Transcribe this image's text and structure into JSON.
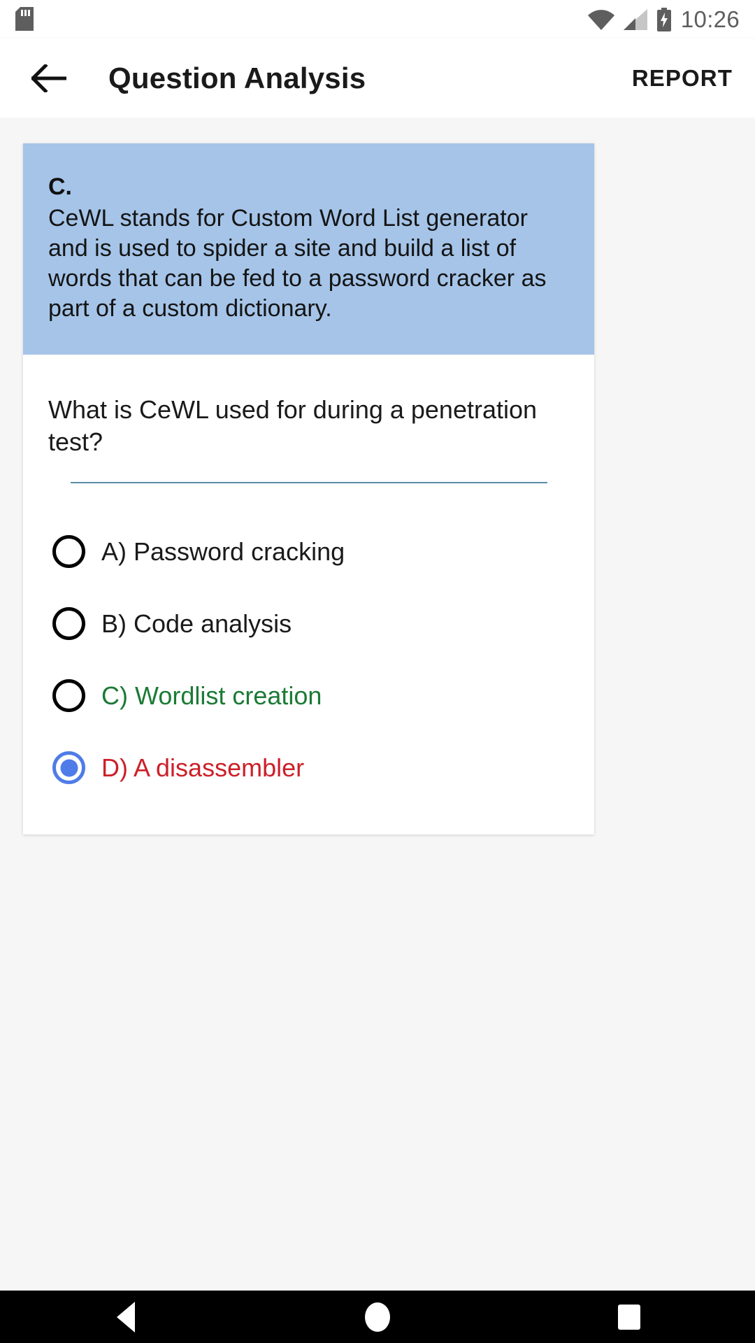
{
  "status_bar": {
    "time": "10:26",
    "icons": [
      "sd-card-icon",
      "wifi-icon",
      "cellular-signal-icon",
      "battery-charging-icon"
    ]
  },
  "app_bar": {
    "back_label": "back-arrow",
    "title": "Question Analysis",
    "action_label": "REPORT"
  },
  "explanation": {
    "letter": "C.",
    "text": "CeWL stands for Custom Word List generator and is used to spider a site and build a list of words that can be fed to a password cracker as part of a custom dictionary.",
    "background_color": "#a5c4e8"
  },
  "question": {
    "text": "What is CeWL used for during a penetration test?"
  },
  "options": [
    {
      "label": "A) Password cracking",
      "selected": false,
      "state": "neutral"
    },
    {
      "label": "B) Code analysis",
      "selected": false,
      "state": "neutral"
    },
    {
      "label": "C) Wordlist creation",
      "selected": false,
      "state": "correct"
    },
    {
      "label": "D) A disassembler",
      "selected": true,
      "state": "wrong"
    }
  ],
  "colors": {
    "correct": "#1b7a35",
    "wrong": "#cc2029",
    "radio_selected": "#4f7ce8",
    "divider": "#5b8ba8"
  },
  "nav_bar": {
    "buttons": [
      "back-triangle-icon",
      "home-circle-icon",
      "recents-square-icon"
    ]
  }
}
